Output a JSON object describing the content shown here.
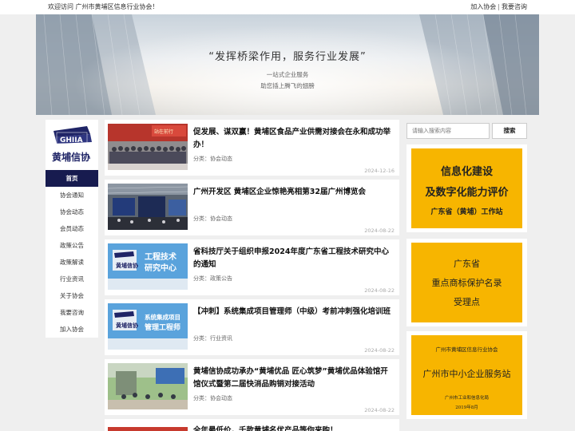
{
  "topbar": {
    "welcome": "欢迎访问 广州市黄埔区信息行业协会！",
    "join": "加入协会",
    "separator": "|",
    "consult": "我要咨询"
  },
  "banner": {
    "slogan": "“发挥桥梁作用，服务行业发展”",
    "sub1": "一站式企业服务",
    "sub2": "助您插上腾飞的翅膀"
  },
  "logo": {
    "text": "GHIIA",
    "name": "黄埔信协"
  },
  "nav": {
    "items": [
      "首页",
      "协会通知",
      "协会动态",
      "会员动态",
      "政策公告",
      "政策解读",
      "行业资讯",
      "关于协会",
      "我要咨询",
      "加入协会"
    ]
  },
  "news": [
    {
      "title": "促发展、谋双赢！黄埔区食品产业供需对接会在永和成功举办！",
      "category": "分类：协会动态",
      "date": "2024-12-16",
      "thumb_text": "站在前行"
    },
    {
      "title": "广州开发区 黄埔区企业惊艳亮相第32届广州博览会",
      "category": "分类：协会动态",
      "date": "2024-08-22"
    },
    {
      "title": "省科技厅关于组织申报2024年度广东省工程技术研究中心的通知",
      "category": "分类：政策公告",
      "date": "2024-08-22",
      "thumb_line1": "工程技术",
      "thumb_line2": "研究中心"
    },
    {
      "title": "【冲刺】系统集成项目管理师（中级）考前冲刺强化培训班",
      "category": "分类：行业资讯",
      "date": "2024-08-22",
      "thumb_line1": "系统集成项目",
      "thumb_line2": "管理工程师"
    },
    {
      "title": "黄埔信协成功承办“黄埔优品 匠心筑梦”黄埔优品体验馆开馆仪式暨第二届快消品购销对接活动",
      "category": "分类：协会动态",
      "date": "2024-08-22"
    },
    {
      "title": "全年最低价，千款黄埔名优产品等你来购！"
    }
  ],
  "search": {
    "placeholder": "请输入搜索内容",
    "button": "搜索"
  },
  "ads": {
    "ad1": {
      "line1": "信息化建设",
      "line2": "及数字化能力评价",
      "line3": "广东省（黄埔）工作站"
    },
    "ad2": {
      "line1": "广东省",
      "line2": "重点商标保护名录",
      "line3": "受理点"
    },
    "ad3": {
      "line1": "广州市黄埔区信息行业协会",
      "line2": "广州市中小企业服务站",
      "line3": "广州市工业和信息化局",
      "line4": "2019年8月"
    }
  },
  "colors": {
    "nav_active": "#171b4f",
    "ad_yellow": "#f7b500",
    "page_bg": "#efefef"
  }
}
